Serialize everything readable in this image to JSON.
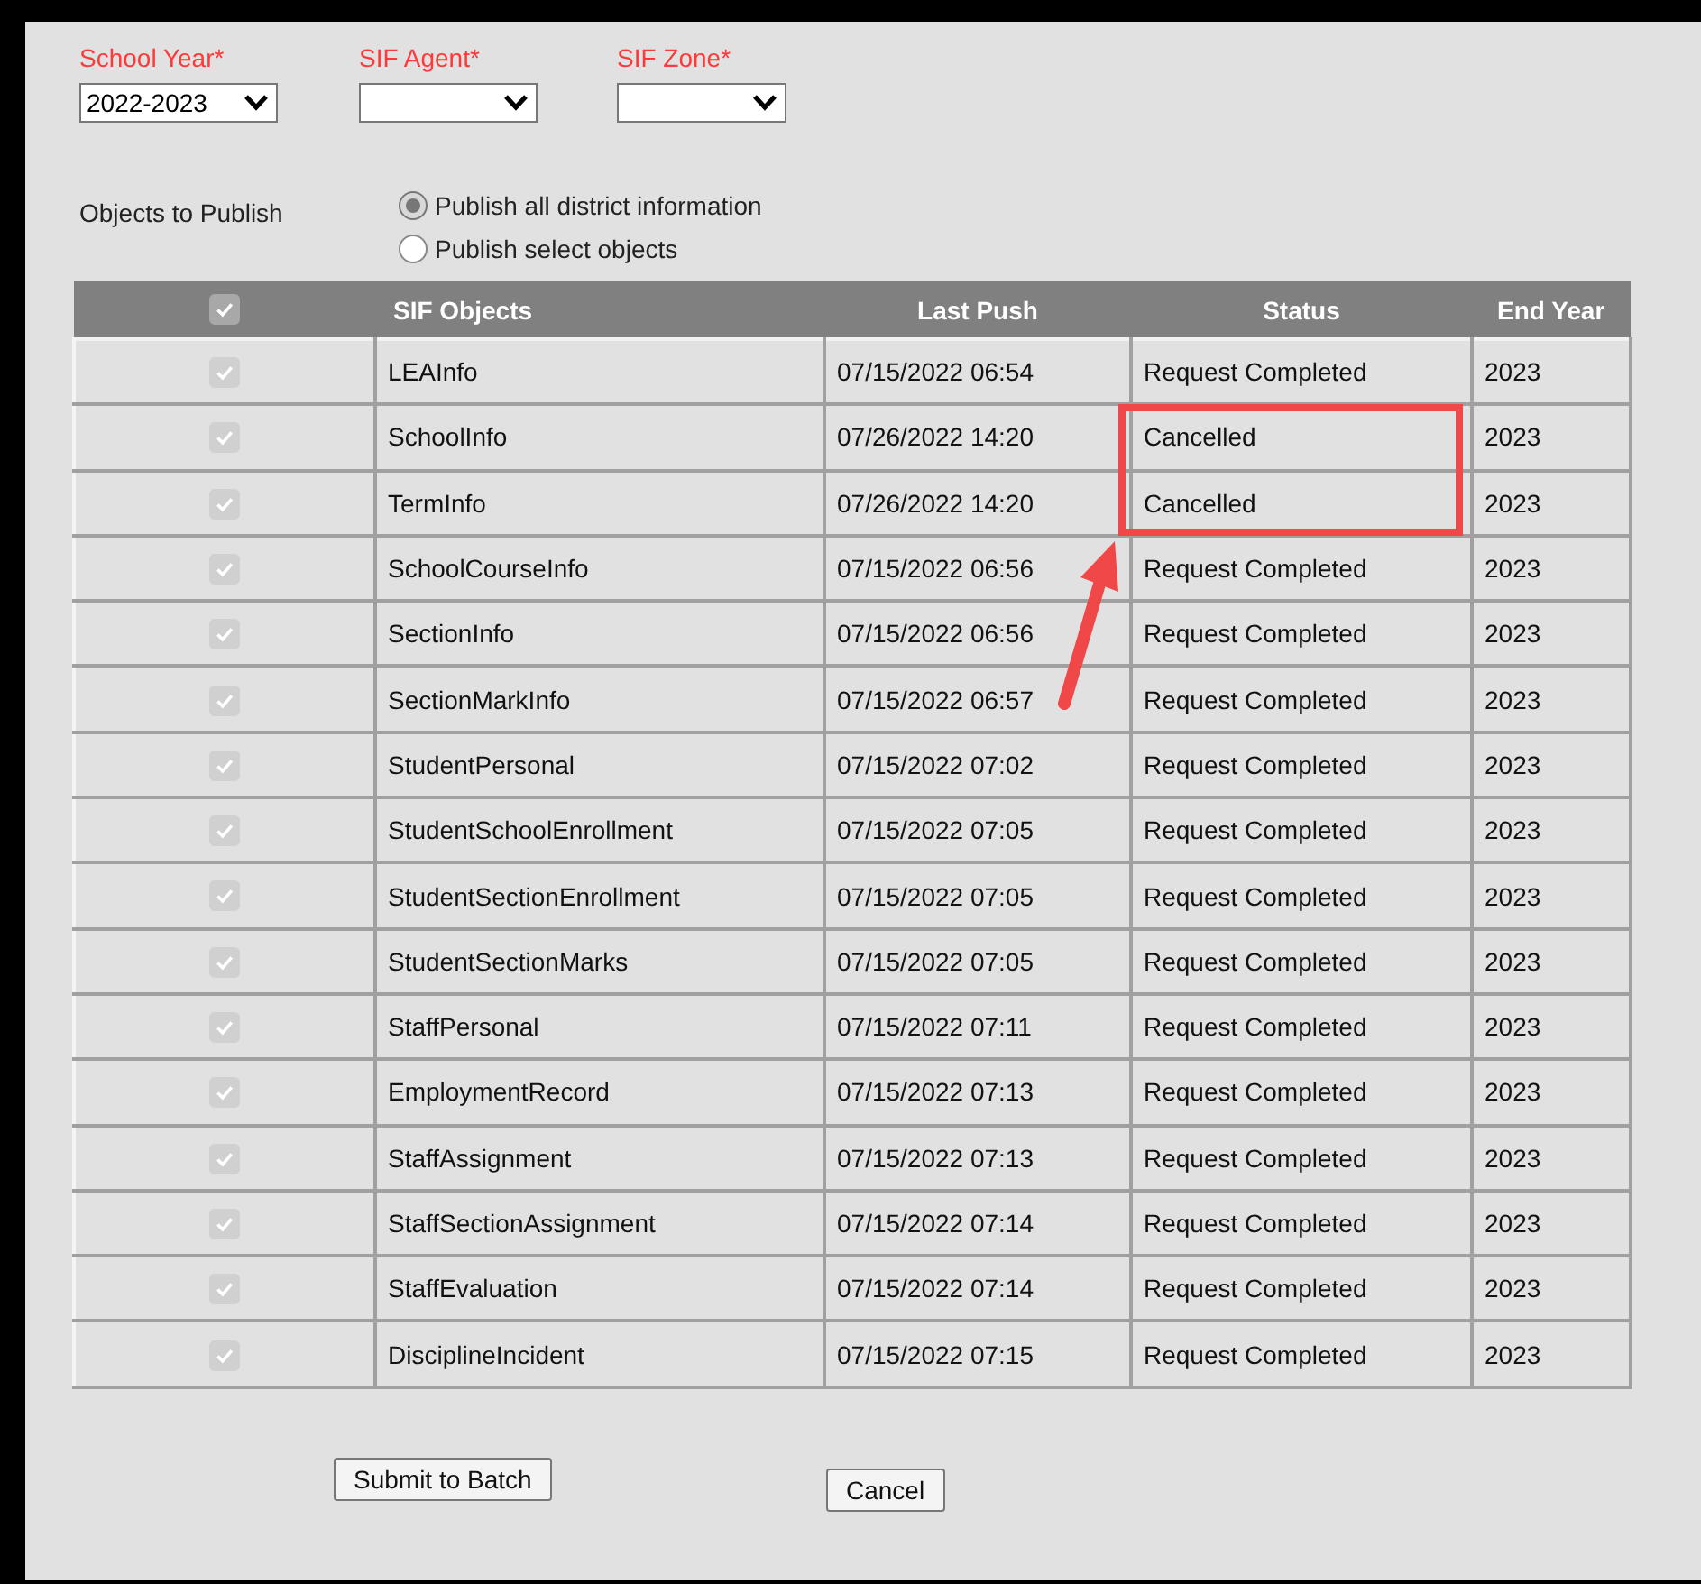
{
  "filters": [
    {
      "label": "School Year*",
      "value": "2022-2023"
    },
    {
      "label": "SIF Agent*"
    },
    {
      "label": "SIF Zone*"
    }
  ],
  "publish": {
    "label": "Objects to Publish",
    "options": [
      {
        "label": "Publish all district information",
        "selected": true
      },
      {
        "label": "Publish select objects",
        "selected": false
      }
    ]
  },
  "table": {
    "header_checkbox": {
      "checked": true,
      "disabled": true
    },
    "columns": [
      "SIF Objects",
      "Last Push",
      "Status",
      "End Year"
    ],
    "rows": [
      {
        "checked": true,
        "disabled": true,
        "highlighted": false,
        "object": "LEAInfo",
        "last_push": "07/15/2022 06:54",
        "status": "Request Completed",
        "end_year": "2023"
      },
      {
        "checked": true,
        "disabled": true,
        "highlighted": true,
        "object": "SchoolInfo",
        "last_push": "07/26/2022 14:20",
        "status": "Cancelled",
        "end_year": "2023"
      },
      {
        "checked": true,
        "disabled": true,
        "highlighted": true,
        "object": "TermInfo",
        "last_push": "07/26/2022 14:20",
        "status": "Cancelled",
        "end_year": "2023"
      },
      {
        "checked": true,
        "disabled": true,
        "highlighted": false,
        "object": "SchoolCourseInfo",
        "last_push": "07/15/2022 06:56",
        "status": "Request Completed",
        "end_year": "2023"
      },
      {
        "checked": true,
        "disabled": true,
        "highlighted": false,
        "object": "SectionInfo",
        "last_push": "07/15/2022 06:56",
        "status": "Request Completed",
        "end_year": "2023"
      },
      {
        "checked": true,
        "disabled": true,
        "highlighted": false,
        "object": "SectionMarkInfo",
        "last_push": "07/15/2022 06:57",
        "status": "Request Completed",
        "end_year": "2023"
      },
      {
        "checked": true,
        "disabled": true,
        "highlighted": false,
        "object": "StudentPersonal",
        "last_push": "07/15/2022 07:02",
        "status": "Request Completed",
        "end_year": "2023"
      },
      {
        "checked": true,
        "disabled": true,
        "highlighted": false,
        "object": "StudentSchoolEnrollment",
        "last_push": "07/15/2022 07:05",
        "status": "Request Completed",
        "end_year": "2023"
      },
      {
        "checked": true,
        "disabled": true,
        "highlighted": false,
        "object": "StudentSectionEnrollment",
        "last_push": "07/15/2022 07:05",
        "status": "Request Completed",
        "end_year": "2023"
      },
      {
        "checked": true,
        "disabled": true,
        "highlighted": false,
        "object": "StudentSectionMarks",
        "last_push": "07/15/2022 07:05",
        "status": "Request Completed",
        "end_year": "2023"
      },
      {
        "checked": true,
        "disabled": true,
        "highlighted": false,
        "object": "StaffPersonal",
        "last_push": "07/15/2022 07:11",
        "status": "Request Completed",
        "end_year": "2023"
      },
      {
        "checked": true,
        "disabled": true,
        "highlighted": false,
        "object": "EmploymentRecord",
        "last_push": "07/15/2022 07:13",
        "status": "Request Completed",
        "end_year": "2023"
      },
      {
        "checked": true,
        "disabled": true,
        "highlighted": false,
        "object": "StaffAssignment",
        "last_push": "07/15/2022 07:13",
        "status": "Request Completed",
        "end_year": "2023"
      },
      {
        "checked": true,
        "disabled": true,
        "highlighted": false,
        "object": "StaffSectionAssignment",
        "last_push": "07/15/2022 07:14",
        "status": "Request Completed",
        "end_year": "2023"
      },
      {
        "checked": true,
        "disabled": true,
        "highlighted": false,
        "object": "StaffEvaluation",
        "last_push": "07/15/2022 07:14",
        "status": "Request Completed",
        "end_year": "2023"
      },
      {
        "checked": true,
        "disabled": true,
        "highlighted": false,
        "object": "DisciplineIncident",
        "last_push": "07/15/2022 07:15",
        "status": "Request Completed",
        "end_year": "2023"
      }
    ]
  },
  "buttons": [
    "Submit to Batch",
    "Cancel"
  ]
}
